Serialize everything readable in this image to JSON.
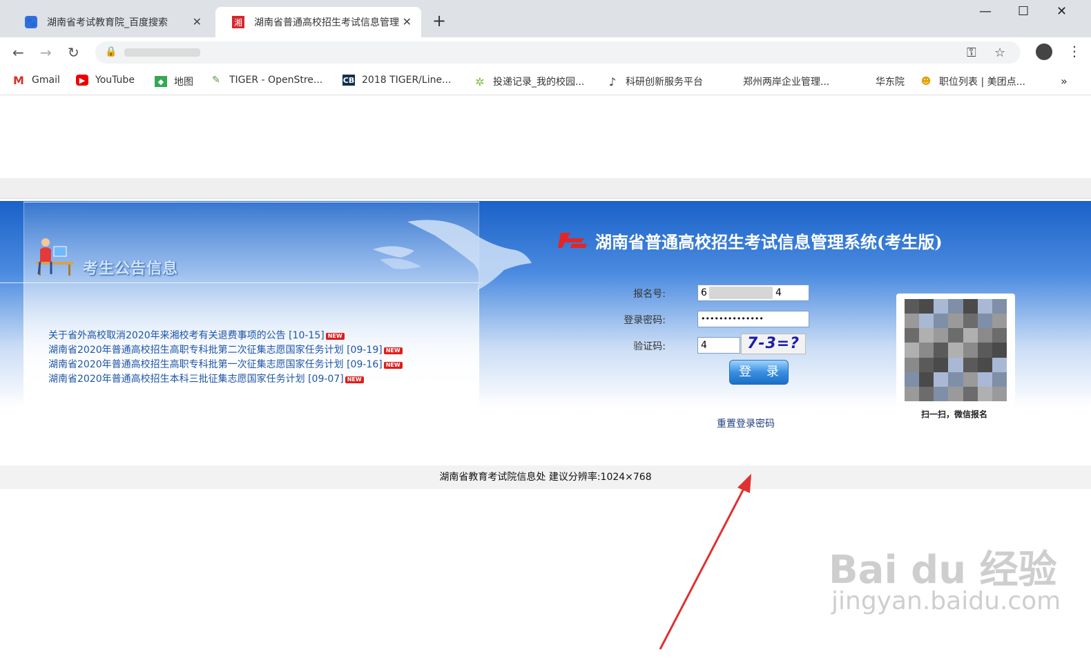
{
  "browser": {
    "tabs": [
      {
        "title": "湖南省考试教育院_百度搜索",
        "icon": "baidu-paw-icon"
      },
      {
        "title": "湖南省普通高校招生考试信息管理",
        "icon": "xiang-logo-icon"
      }
    ],
    "new_tab": "+",
    "bookmarks": [
      {
        "label": "Gmail",
        "icon": "gmail-icon"
      },
      {
        "label": "YouTube",
        "icon": "youtube-icon"
      },
      {
        "label": "地图",
        "icon": "maps-icon"
      },
      {
        "label": "TIGER - OpenStre...",
        "icon": "tiger-icon"
      },
      {
        "label": "2018 TIGER/Line...",
        "icon": "cb-icon"
      },
      {
        "label": "投递记录_我的校园...",
        "icon": "campus-icon"
      },
      {
        "label": "科研创新服务平台",
        "icon": "research-icon"
      },
      {
        "label": "郑州两岸企业管理...",
        "icon": ""
      },
      {
        "label": "华东院",
        "icon": ""
      },
      {
        "label": "职位列表 | 美团点...",
        "icon": "meituan-icon"
      }
    ],
    "more_bookmarks": "»"
  },
  "page": {
    "notice_title": "考生公告信息",
    "news": [
      {
        "text": "关于省外高校取消2020年来湘校考有关退费事项的公告 [10-15]",
        "badge": "NEW"
      },
      {
        "text": "湖南省2020年普通高校招生高职专科批第二次征集志愿国家任务计划 [09-19]",
        "badge": "NEW"
      },
      {
        "text": "湖南省2020年普通高校招生高职专科批第一次征集志愿国家任务计划 [09-16]",
        "badge": "NEW"
      },
      {
        "text": "湖南省2020年普通高校招生本科三批征集志愿国家任务计划 [09-07]",
        "badge": "NEW"
      }
    ],
    "system_title": "湖南省普通高校招生考试信息管理系统(考生版)",
    "form": {
      "id_label": "报名号:",
      "id_value_start": "6",
      "id_value_end": "4",
      "password_label": "登录密码:",
      "password_value": "••••••••••••••",
      "captcha_label": "验证码:",
      "captcha_value": "4",
      "captcha_image_text": "7-3=?",
      "login_label": "登 录",
      "reset_label": "重置登录密码"
    },
    "qr_caption": "扫一扫，微信报名",
    "footer": "湖南省教育考试院信息处  建议分辨率:1024×768"
  },
  "watermark": {
    "line1": "Bai du 经验",
    "line2": "jingyan.baidu.com"
  }
}
